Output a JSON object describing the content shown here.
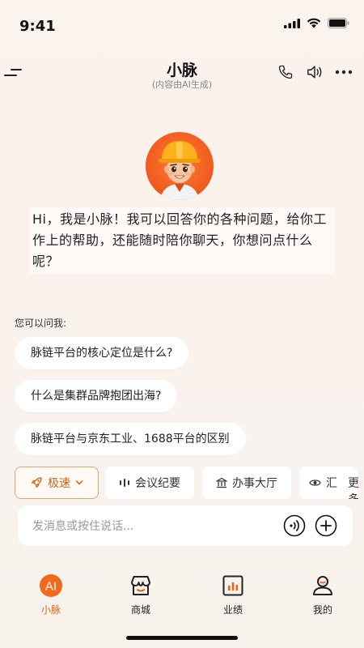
{
  "status_bar": {
    "time": "9:41",
    "icons": [
      "cellular-signal-icon",
      "wifi-icon",
      "battery-icon"
    ]
  },
  "header": {
    "title": "小脉",
    "subtitle": "(内容由AI生成)",
    "icons": [
      "menu-icon",
      "phone-icon",
      "speaker-icon",
      "more-icon"
    ]
  },
  "greeting": {
    "text": "Hi，我是小脉！我可以回答你的各种问题，给你工作上的帮助，还能随时陪你聊天，你想问点什么呢？"
  },
  "suggestions": {
    "label": "您可以问我:",
    "items": [
      "脉链平台的核心定位是什么?",
      "什么是集群品牌抱团出海?",
      "脉链平台与京东工业、1688平台的区别"
    ]
  },
  "chips": {
    "speed": "极速",
    "minutes": "会议纪要",
    "hall": "办事大厅",
    "report": "汇",
    "more": "更多"
  },
  "input": {
    "placeholder": "发消息或按住说话..."
  },
  "tabs": [
    {
      "label": "小脉",
      "icon": "ai-icon",
      "active": true
    },
    {
      "label": "商城",
      "icon": "store-icon",
      "active": false
    },
    {
      "label": "业绩",
      "icon": "chart-icon",
      "active": false
    },
    {
      "label": "我的",
      "icon": "profile-icon",
      "active": false
    }
  ],
  "colors": {
    "accent": "#e8620f",
    "background": "#fbf3ee"
  }
}
